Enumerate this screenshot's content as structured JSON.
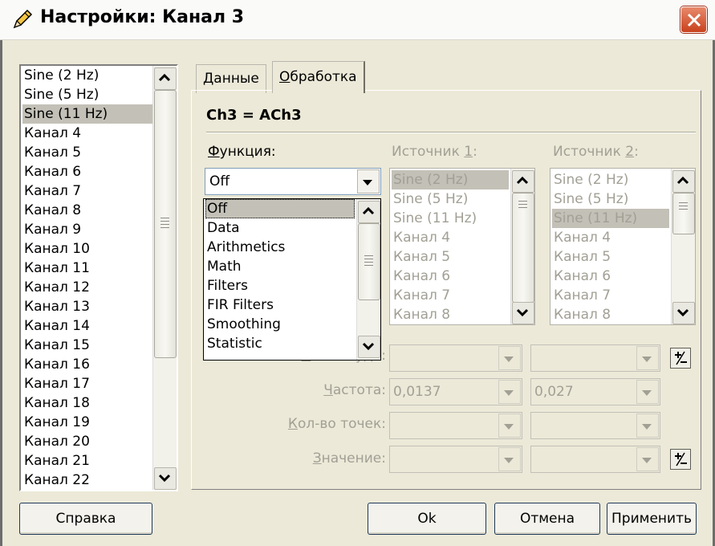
{
  "window": {
    "title": "Настройки: Канал 3"
  },
  "channel_list": {
    "items": [
      "Sine (2 Hz)",
      "Sine (5 Hz)",
      "Sine (11 Hz)",
      "Канал 4",
      "Канал 5",
      "Канал 6",
      "Канал 7",
      "Канал 8",
      "Канал 9",
      "Канал 10",
      "Канал 11",
      "Канал 12",
      "Канал 13",
      "Канал 14",
      "Канал 15",
      "Канал 16",
      "Канал 17",
      "Канал 18",
      "Канал 19",
      "Канал 20",
      "Канал 21",
      "Канал 22"
    ],
    "selected": "Sine (11 Hz)"
  },
  "tabs": [
    {
      "label": "Данные",
      "mnemonic": "Д",
      "rest": "анные"
    },
    {
      "label": "Обработка",
      "mnemonic": "О",
      "rest": "бработка"
    }
  ],
  "panel": {
    "formula": "Ch3 = ACh3",
    "function_label": {
      "mnemonic": "Ф",
      "rest": "ункция:"
    },
    "function_value": "Off",
    "function_options": [
      "Off",
      "Data",
      "Arithmetics",
      "Math",
      "Filters",
      "FIR Filters",
      "Smoothing",
      "Statistic"
    ],
    "source1_label": {
      "prefix": "Источник ",
      "mnemonic": "1",
      "suffix": ":"
    },
    "source2_label": {
      "prefix": "Источник ",
      "mnemonic": "2",
      "suffix": ":"
    },
    "source1_items": [
      "Sine (2 Hz)",
      "Sine (5 Hz)",
      "Sine (11 Hz)",
      "Канал 4",
      "Канал 5",
      "Канал 6",
      "Канал 7",
      "Канал 8"
    ],
    "source1_selected": "Sine (2 Hz)",
    "source2_items": [
      "Sine (2 Hz)",
      "Sine (5 Hz)",
      "Sine (11 Hz)",
      "Канал 4",
      "Канал 5",
      "Канал 6",
      "Канал 7",
      "Канал 8"
    ],
    "source2_selected": "Sine (11 Hz)",
    "amplitude_label": {
      "mnemonic": "А",
      "rest": "мплитуда:"
    },
    "frequency_label": {
      "mnemonic": "Ч",
      "rest": "астота:"
    },
    "points_label": {
      "mnemonic": "К",
      "rest": "ол-во точек:"
    },
    "value_label": {
      "mnemonic": "З",
      "rest": "начение:"
    },
    "frequency_value1": "0,0137",
    "frequency_value2": "0,027"
  },
  "buttons": {
    "help": "Справка",
    "ok": "Ok",
    "cancel": "Отмена",
    "apply": "Применить"
  },
  "colors": {
    "close": "#d0502a",
    "selection": "#c3c1b7",
    "disabled_text": "#a2a095"
  }
}
